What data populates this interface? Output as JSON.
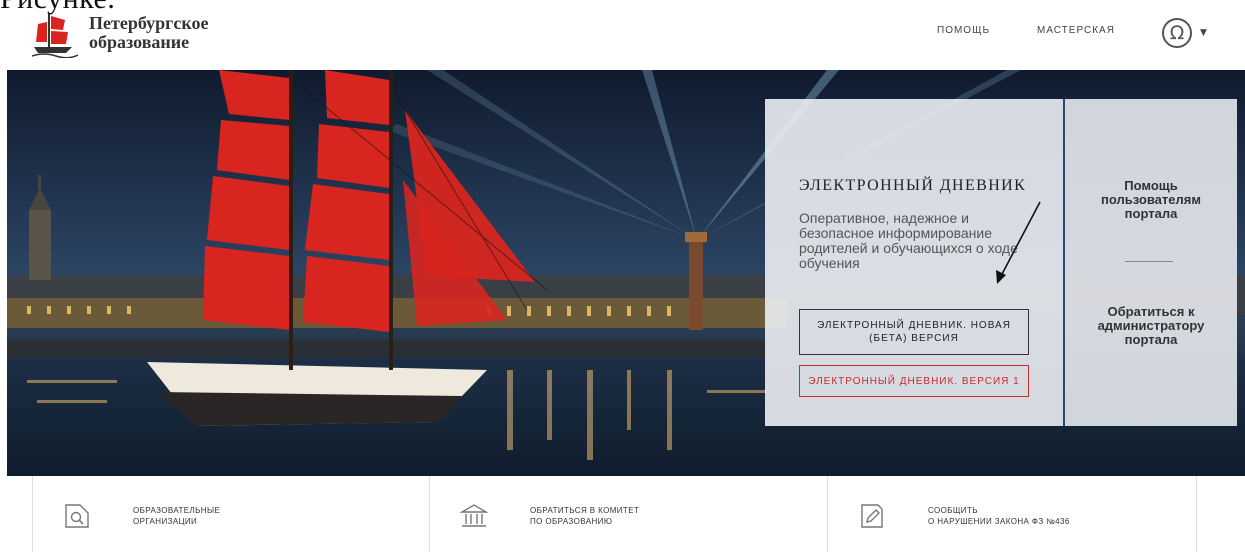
{
  "caption_fragment": "Рисунке.",
  "header": {
    "logo_line1": "Петербургское",
    "logo_line2": "образование",
    "nav_help": "ПОМОЩЬ",
    "nav_workshop": "МАСТЕРСКАЯ",
    "user_icon": "user-circle-icon"
  },
  "panel": {
    "title": "ЭЛЕКТРОННЫЙ ДНЕВНИК",
    "description": "Оперативное, надежное и безопасное информирование родителей и обучающихся о ходе обучения",
    "button_new": "ЭЛЕКТРОННЫЙ ДНЕВНИК. НОВАЯ (БЕТА) ВЕРСИЯ",
    "button_old": "ЭЛЕКТРОННЫЙ ДНЕВНИК. ВЕРСИЯ 1"
  },
  "side_panel": {
    "help": "Помощь пользователям портала",
    "admin": "Обратиться к администратору портала"
  },
  "bottom": [
    {
      "line1": "ОБРАЗОВАТЕЛЬНЫЕ",
      "line2": "ОРГАНИЗАЦИИ",
      "icon": "document-search-icon"
    },
    {
      "line1": "ОБРАТИТЬСЯ В КОМИТЕТ",
      "line2": "ПО ОБРАЗОВАНИЮ",
      "icon": "institution-icon"
    },
    {
      "line1": "СООБЩИТЬ",
      "line2": "О НАРУШЕНИИ ЗАКОНА ФЗ №436",
      "icon": "edit-document-icon"
    }
  ],
  "colors": {
    "accent_red": "#c62c2c",
    "divider_blue": "#2a4778",
    "sail_red": "#d8251f"
  }
}
